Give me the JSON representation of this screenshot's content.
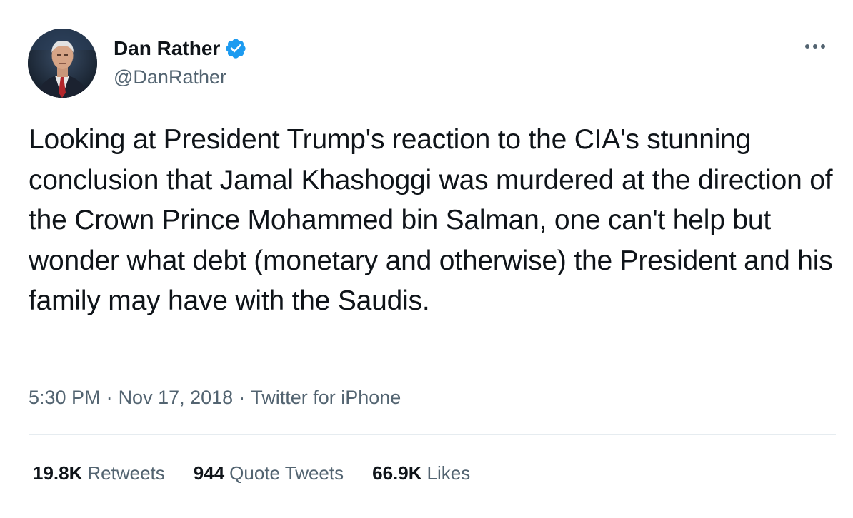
{
  "author": {
    "display_name": "Dan Rather",
    "handle": "@DanRather",
    "verified": true,
    "verified_color": "#1d9bf0"
  },
  "tweet": {
    "text": "Looking at President Trump's reaction to the CIA's stunning conclusion that Jamal Khashoggi was murdered at the direction of the Crown Prince Mohammed bin Salman, one can't help but wonder what debt (monetary and otherwise) the President and his family may have with the Saudis.",
    "time": "5:30 PM",
    "date": "Nov 17, 2018",
    "separator": "·",
    "source": "Twitter for iPhone"
  },
  "stats": {
    "retweets": {
      "count": "19.8K",
      "label": "Retweets"
    },
    "quotes": {
      "count": "944",
      "label": "Quote Tweets"
    },
    "likes": {
      "count": "66.9K",
      "label": "Likes"
    }
  },
  "icons": {
    "more": "more-horizontal-icon",
    "verified": "verified-badge-icon"
  },
  "colors": {
    "text_primary": "#0f1419",
    "text_secondary": "#536471",
    "divider": "#e6ecf0"
  }
}
